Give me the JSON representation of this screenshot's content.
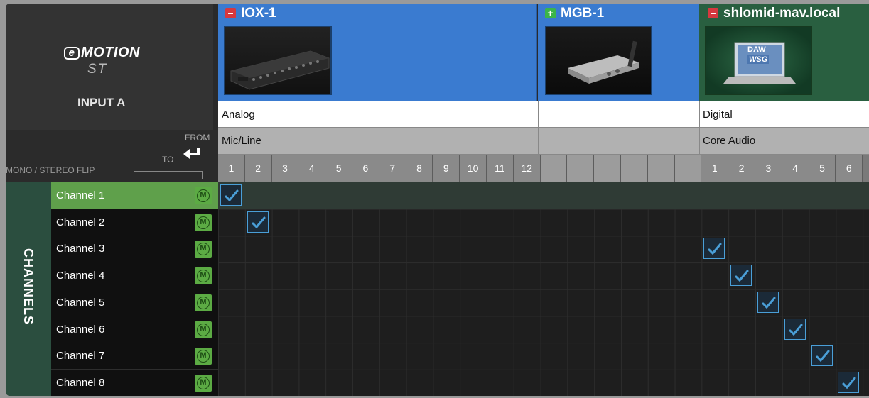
{
  "logo": {
    "line1_letter": "e",
    "line1_rest": "MOTION",
    "line2": "ST"
  },
  "input_name": "INPUT A",
  "labels": {
    "from": "FROM",
    "to": "TO",
    "mono_stereo_flip": "MONO / STEREO FLIP",
    "channels": "CHANNELS"
  },
  "devices": [
    {
      "name": "IOX-1",
      "state": "collapse",
      "badge": "–",
      "type": "Analog",
      "subtype": "Mic/Line",
      "columns": [
        "1",
        "2",
        "3",
        "4",
        "5",
        "6",
        "7",
        "8",
        "9",
        "10",
        "11",
        "12"
      ]
    },
    {
      "name": "MGB-1",
      "state": "expand",
      "badge": "+",
      "type": "",
      "subtype": "",
      "columns": []
    },
    {
      "name": "shlomid-mav.local",
      "state": "collapse",
      "badge": "–",
      "type": "Digital",
      "subtype": "Core Audio",
      "columns": [
        "1",
        "2",
        "3",
        "4",
        "5",
        "6"
      ],
      "thumb_text_top": "DAW",
      "thumb_text_bottom": "WSG"
    }
  ],
  "channels": [
    {
      "label": "Channel 1",
      "selected": true,
      "mono_button": "M"
    },
    {
      "label": "Channel 2",
      "selected": false,
      "mono_button": "M"
    },
    {
      "label": "Channel 3",
      "selected": false,
      "mono_button": "M"
    },
    {
      "label": "Channel 4",
      "selected": false,
      "mono_button": "M"
    },
    {
      "label": "Channel 5",
      "selected": false,
      "mono_button": "M"
    },
    {
      "label": "Channel 6",
      "selected": false,
      "mono_button": "M"
    },
    {
      "label": "Channel 7",
      "selected": false,
      "mono_button": "M"
    },
    {
      "label": "Channel 8",
      "selected": false,
      "mono_button": "M"
    }
  ],
  "routes": [
    {
      "channel": "Channel 1",
      "device": "IOX-1",
      "column": "1"
    },
    {
      "channel": "Channel 2",
      "device": "IOX-1",
      "column": "2"
    },
    {
      "channel": "Channel 3",
      "device": "shlomid-mav.local",
      "column": "1"
    },
    {
      "channel": "Channel 4",
      "device": "shlomid-mav.local",
      "column": "2"
    },
    {
      "channel": "Channel 5",
      "device": "shlomid-mav.local",
      "column": "3"
    },
    {
      "channel": "Channel 6",
      "device": "shlomid-mav.local",
      "column": "4"
    },
    {
      "channel": "Channel 7",
      "device": "shlomid-mav.local",
      "column": "5"
    },
    {
      "channel": "Channel 8",
      "device": "shlomid-mav.local",
      "column": "6"
    }
  ],
  "colors": {
    "device_selected": "#3a7bd0",
    "device_computer": "#295f40",
    "channel_selected": "#5fa04b",
    "check": "#4a9fd8",
    "mono_button": "#5cab44"
  }
}
